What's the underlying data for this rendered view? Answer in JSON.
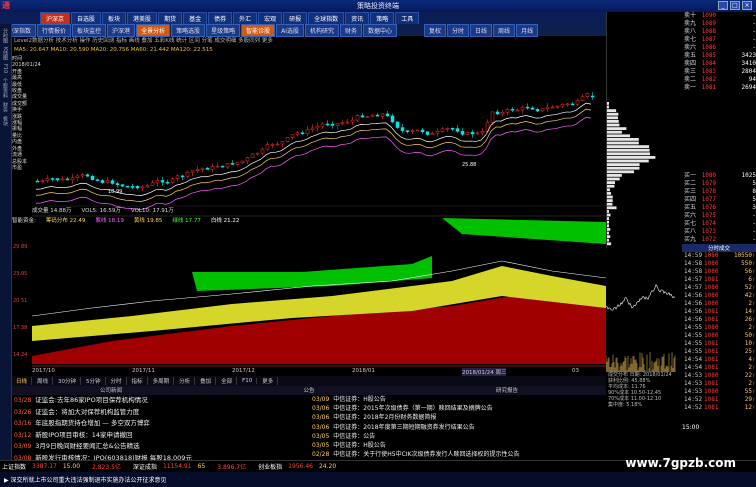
{
  "titlebar": {
    "title": "策略投资终端",
    "logo": "通"
  },
  "menu": [
    "沪深京",
    "自选股",
    "板块",
    "港美股",
    "期货",
    "基金",
    "债券",
    "外汇",
    "宏观",
    "研报",
    "全球指数",
    "资讯",
    "策略",
    "工具"
  ],
  "toolbar": [
    "沪深指数",
    "行情报价",
    "板块监控",
    "沪深港",
    "全景分析",
    "策略选股",
    "星级策略",
    "智能诊股",
    "AI选股",
    "机构研究",
    "财务",
    "数据中心"
  ],
  "rhead": [
    "复权",
    "分时",
    "日线",
    "周线",
    "月线"
  ],
  "sidebar": [
    "分时图",
    "K线图",
    "F10",
    "个股资料",
    "财务",
    "板块"
  ],
  "info": {
    "line1": "Level2数据分析 技术分析 操作 历史回测 指标 画线 叠加 五彩K线 统计 区间 分笔 成交明细 多股同列 更多",
    "line2": "MA5: 20.647  MA10: 20.590  MA20: 20.756  MA60: 21.442  MA120: 22.515"
  },
  "leftpanel": [
    "时间",
    "2018/01/24",
    "开盘",
    "最高",
    "最低",
    "收盘",
    "成交量",
    "成交额",
    "换手",
    "涨跌",
    "涨幅",
    "振幅",
    "量比",
    "内盘",
    "外盘",
    "流通",
    "总股本",
    "市盈"
  ],
  "chart": {
    "low_label": "18.99",
    "high_label": "25.88"
  },
  "chart_yaxis": [
    "29.89",
    "23.95",
    "20.51",
    "17.38",
    "14.24",
    "11.09"
  ],
  "volbar": [
    "成交量 14.88万",
    "VOL5: 16.59万",
    "VOL10: 17.91万"
  ],
  "indicator": [
    "智能资金:",
    "筹码分布 22.49",
    "紫线 18.19",
    "黄线 19.85",
    "绿线 17.77",
    "白线 21.22"
  ],
  "dates": [
    "2017/10",
    "2017/11",
    "2017/12",
    "2018/01",
    "2018/01/24 周三",
    "03"
  ],
  "bottom_tabs": [
    "日线",
    "周线",
    "30分钟",
    "5分钟",
    "分时",
    "指标",
    "多周期",
    "分析",
    "叠加",
    "全部",
    "F10",
    "更多"
  ],
  "news_head": [
    "公司新闻",
    "公告",
    "研究报告"
  ],
  "news_left": [
    {
      "date": "03/28",
      "text": "证监会:去年86家IPO项目保荐机构情况",
      "hl": false
    },
    {
      "date": "03/26",
      "text": "证监会：将加大对保荐机构监管力度",
      "hl": false
    },
    {
      "date": "03/16",
      "text": "年底股指期货持仓增加 — 多空双方博弈",
      "hl": false
    },
    {
      "date": "03/12",
      "text": "新股IPO项目审核：14家申请撤回",
      "hl": false
    },
    {
      "date": "03/09",
      "text": "3月9日晚间财经要闻汇总&公告精选",
      "hl": false
    },
    {
      "date": "03/08",
      "text": "新股发行审核情况：IPO(603818)财报 每股18.009元",
      "hl": false
    },
    {
      "date": "03/05",
      "text": "热门概念龙头大全概念及分析 看完榜单就知道了",
      "hl": false
    }
  ],
  "news_mid": [
    {
      "date": "03/09",
      "text": "中信证券：H股公告"
    },
    {
      "date": "03/06",
      "text": "中信证券：2015年次级债券（第一期）赎回结果及摘牌公告"
    },
    {
      "date": "03/06",
      "text": "中信证券：2018年2月份财务数据简报"
    },
    {
      "date": "03/06",
      "text": "中信证券：2018年度第三期短期融资券发行结果公告"
    },
    {
      "date": "03/05",
      "text": "中信证券：公告"
    },
    {
      "date": "03/05",
      "text": "中信证券：H股公告"
    },
    {
      "date": "02/28",
      "text": "中信证券：关于行使H5中CIK次级债券发行人赎回选择权的提示性公告"
    }
  ],
  "sell": [
    {
      "lbl": "卖十",
      "px": "1090",
      "vol": "-"
    },
    {
      "lbl": "卖九",
      "px": "1089",
      "vol": "-"
    },
    {
      "lbl": "卖八",
      "px": "1088",
      "vol": "-"
    },
    {
      "lbl": "卖七",
      "px": "1087",
      "vol": "-"
    },
    {
      "lbl": "卖六",
      "px": "1086",
      "vol": "-"
    },
    {
      "lbl": "卖五",
      "px": "1085",
      "vol": "3423"
    },
    {
      "lbl": "卖四",
      "px": "1084",
      "vol": "3410"
    },
    {
      "lbl": "卖三",
      "px": "1083",
      "vol": "2804"
    },
    {
      "lbl": "卖二",
      "px": "1082",
      "vol": "94"
    },
    {
      "lbl": "卖一",
      "px": "1081",
      "vol": "2694"
    }
  ],
  "buy": [
    {
      "lbl": "买一",
      "px": "1080",
      "vol": "1025"
    },
    {
      "lbl": "买二",
      "px": "1079",
      "vol": "5"
    },
    {
      "lbl": "买三",
      "px": "1078",
      "vol": "8"
    },
    {
      "lbl": "买四",
      "px": "1077",
      "vol": "5"
    },
    {
      "lbl": "买五",
      "px": "1076",
      "vol": "3"
    },
    {
      "lbl": "买六",
      "px": "1075",
      "vol": "-"
    },
    {
      "lbl": "买七",
      "px": "1074",
      "vol": "-"
    },
    {
      "lbl": "买八",
      "px": "1073",
      "vol": "-"
    },
    {
      "lbl": "买九",
      "px": "1072",
      "vol": "-"
    },
    {
      "lbl": "买十",
      "px": "1071",
      "vol": "-"
    }
  ],
  "mini_head": "分时成交",
  "trades": [
    {
      "t": "14:59",
      "px": "1080",
      "v": "10550"
    },
    {
      "t": "14:58",
      "px": "1080",
      "v": "550"
    },
    {
      "t": "14:58",
      "px": "1080",
      "v": "56"
    },
    {
      "t": "14:57",
      "px": "1081",
      "v": "6"
    },
    {
      "t": "14:57",
      "px": "1080",
      "v": "52"
    },
    {
      "t": "14:56",
      "px": "1080",
      "v": "42"
    },
    {
      "t": "14:56",
      "px": "1080",
      "v": "2"
    },
    {
      "t": "14:56",
      "px": "1081",
      "v": "14"
    },
    {
      "t": "14:56",
      "px": "1081",
      "v": "26"
    },
    {
      "t": "14:55",
      "px": "1080",
      "v": "2"
    },
    {
      "t": "14:55",
      "px": "1080",
      "v": "50"
    },
    {
      "t": "14:55",
      "px": "1081",
      "v": "10"
    },
    {
      "t": "14:55",
      "px": "1081",
      "v": "25"
    },
    {
      "t": "14:54",
      "px": "1081",
      "v": "4"
    },
    {
      "t": "14:54",
      "px": "1081",
      "v": "2"
    },
    {
      "t": "14:53",
      "px": "1080",
      "v": "22"
    },
    {
      "t": "14:53",
      "px": "1081",
      "v": "2"
    },
    {
      "t": "14:53",
      "px": "1080",
      "v": "55"
    },
    {
      "t": "14:52",
      "px": "1081",
      "v": "29"
    },
    {
      "t": "14:52",
      "px": "1081",
      "v": "12"
    }
  ],
  "ticks_head": [
    "成交分布 日期: 2018/01/24",
    "获利比例: 45.88%",
    "平均成本: 11.76",
    "90%成本 10.50-12.45",
    "70%成本 11.00-12.10",
    "集中度: 5.18%"
  ],
  "time_bottom": "15:00",
  "status": [
    {
      "name": "上证指数",
      "val": "3387.17",
      "val2": "15.00"
    },
    {
      "name": "",
      "val": "2,823.5亿",
      "val2": ""
    },
    {
      "name": "深证成指",
      "val": "11154.91",
      "val2": "65"
    },
    {
      "name": "",
      "val": "3,896.7亿",
      "val2": ""
    },
    {
      "name": "创业板指",
      "val": "1956.46",
      "val2": "24.20"
    },
    {
      "name": "",
      "val": "",
      "val2": ""
    }
  ],
  "ticker": "▶ 深交所就上市公司重大违法强制退市实施办法公开征求意见",
  "watermark": "www.7gpzb.com"
}
